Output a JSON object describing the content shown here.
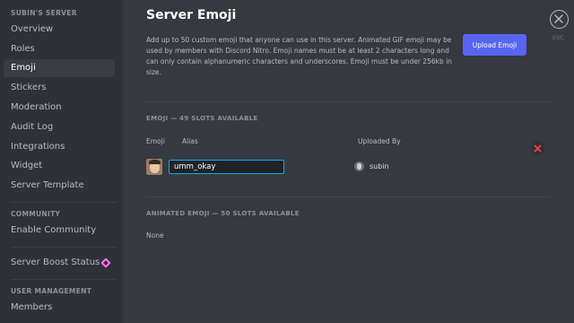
{
  "sidebar": {
    "server_header": "SUBIN'S SERVER",
    "server_items": [
      {
        "label": "Overview"
      },
      {
        "label": "Roles"
      },
      {
        "label": "Emoji"
      },
      {
        "label": "Stickers"
      },
      {
        "label": "Moderation"
      },
      {
        "label": "Audit Log"
      },
      {
        "label": "Integrations"
      },
      {
        "label": "Widget"
      },
      {
        "label": "Server Template"
      }
    ],
    "active_item": "Emoji",
    "community_header": "COMMUNITY",
    "community_items": [
      {
        "label": "Enable Community"
      }
    ],
    "boost_item": {
      "label": "Server Boost Status",
      "icon": "boost-gem-icon"
    },
    "user_management_header": "USER MANAGEMENT",
    "user_management_items": [
      {
        "label": "Members"
      }
    ]
  },
  "main": {
    "title": "Server Emoji",
    "description": "Add up to 50 custom emoji that anyone can use in this server. Animated GIF emoji may be used by members with Discord Nitro. Emoji names must be at least 2 characters long and can only contain alphanumeric characters and underscores. Emoji must be under 256kb in size.",
    "upload_button": "Upload Emoji",
    "close_label": "ESC",
    "emoji_section": {
      "header": "EMOJI — 49 SLOTS AVAILABLE",
      "columns": {
        "emoji": "Emoji",
        "alias": "Alias",
        "uploaded_by": "Uploaded By"
      },
      "rows": [
        {
          "alias": "umm_okay",
          "uploader": "subin"
        }
      ]
    },
    "animated_section": {
      "header": "ANIMATED EMOJI — 50 SLOTS AVAILABLE",
      "empty_text": "None"
    }
  },
  "colors": {
    "background": "#36393f",
    "sidebar": "#2f3136",
    "accent": "#5865f2",
    "danger": "#ed4245",
    "input_focus": "#00b0f4"
  }
}
